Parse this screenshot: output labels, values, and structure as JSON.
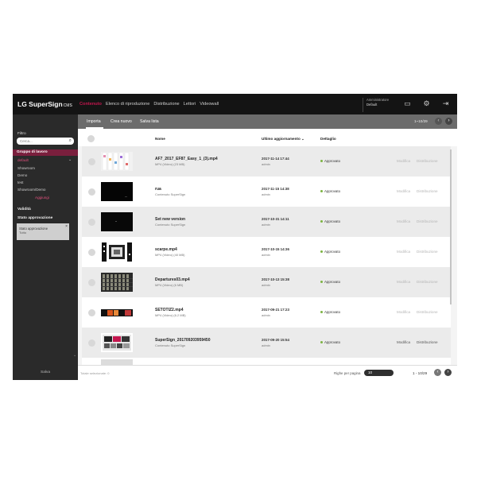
{
  "header": {
    "logo": "LG SuperSign",
    "logo_sub": "CMS",
    "nav": [
      "Contenuto",
      "Elenco di riproduzione",
      "Distribuzione",
      "Lettori",
      "Videowall"
    ],
    "account_role": "Amministratore",
    "account_user": "Default"
  },
  "sidebar": {
    "filter_label": "Filtro",
    "search_placeholder": "Cerca...",
    "group_title": "Gruppo di lavoro",
    "groups": [
      "default",
      "Showroom",
      "Demo",
      "test",
      "Showroom/Demo"
    ],
    "add_link": "Aggiungi",
    "section_validity": "Validità",
    "section_approval": "Stato approvazione",
    "note_title": "Stato approvazione",
    "note_text": "Tutto",
    "bottom": "Salva"
  },
  "toolbar": {
    "import": "Importa",
    "new": "Crea nuovo",
    "save_as": "Salva lista",
    "pager": "1~10/29"
  },
  "table": {
    "col_name": "Nome",
    "col_updated": "Ultimo aggiornamento",
    "col_detail": "Dettaglio",
    "edit_label": "Modifica",
    "dist_label": "Distribuzione",
    "rows": [
      {
        "name": "AF7_2017_EF87_Easy_1_(3).mp4",
        "sub": "MP4 (Video) (23 MB)",
        "date": "2017-11-14 17:44",
        "by": "admin",
        "status": "Approvato",
        "actions_enabled": false
      },
      {
        "name": "rua",
        "sub": "Contenuto SuperSign",
        "date": "2017-11-15 14:38",
        "by": "admin",
        "status": "Approvato",
        "actions_enabled": false
      },
      {
        "name": "Set new version",
        "sub": "Contenuto SuperSign",
        "date": "2017-10-31 14:11",
        "by": "admin",
        "status": "Approvato",
        "actions_enabled": false
      },
      {
        "name": "scarpe.mp4",
        "sub": "MP4 (Video) (40 MB)",
        "date": "2017-10-15 14:36",
        "by": "admin",
        "status": "Approvato",
        "actions_enabled": false
      },
      {
        "name": "Departures03.mp4",
        "sub": "MP4 (Video) (6 MB)",
        "date": "2017-10-13 15:38",
        "by": "admin",
        "status": "Approvato",
        "actions_enabled": false
      },
      {
        "name": "SETOTIZ2.mp4",
        "sub": "MP4 (Video) (6.2 MB)",
        "date": "2017-09-21 17:23",
        "by": "admin",
        "status": "Approvato",
        "actions_enabled": false
      },
      {
        "name": "SuperSign_201709203959450",
        "sub": "Contenuto SuperSign",
        "date": "2017-09-20 15:54",
        "by": "admin",
        "status": "Approvato",
        "actions_enabled": true
      }
    ]
  },
  "footer": {
    "left": "Totale selezionate: 0",
    "per_page_label": "Righe per pagina",
    "per_page_value": "10",
    "range": "1 - 10/29"
  }
}
